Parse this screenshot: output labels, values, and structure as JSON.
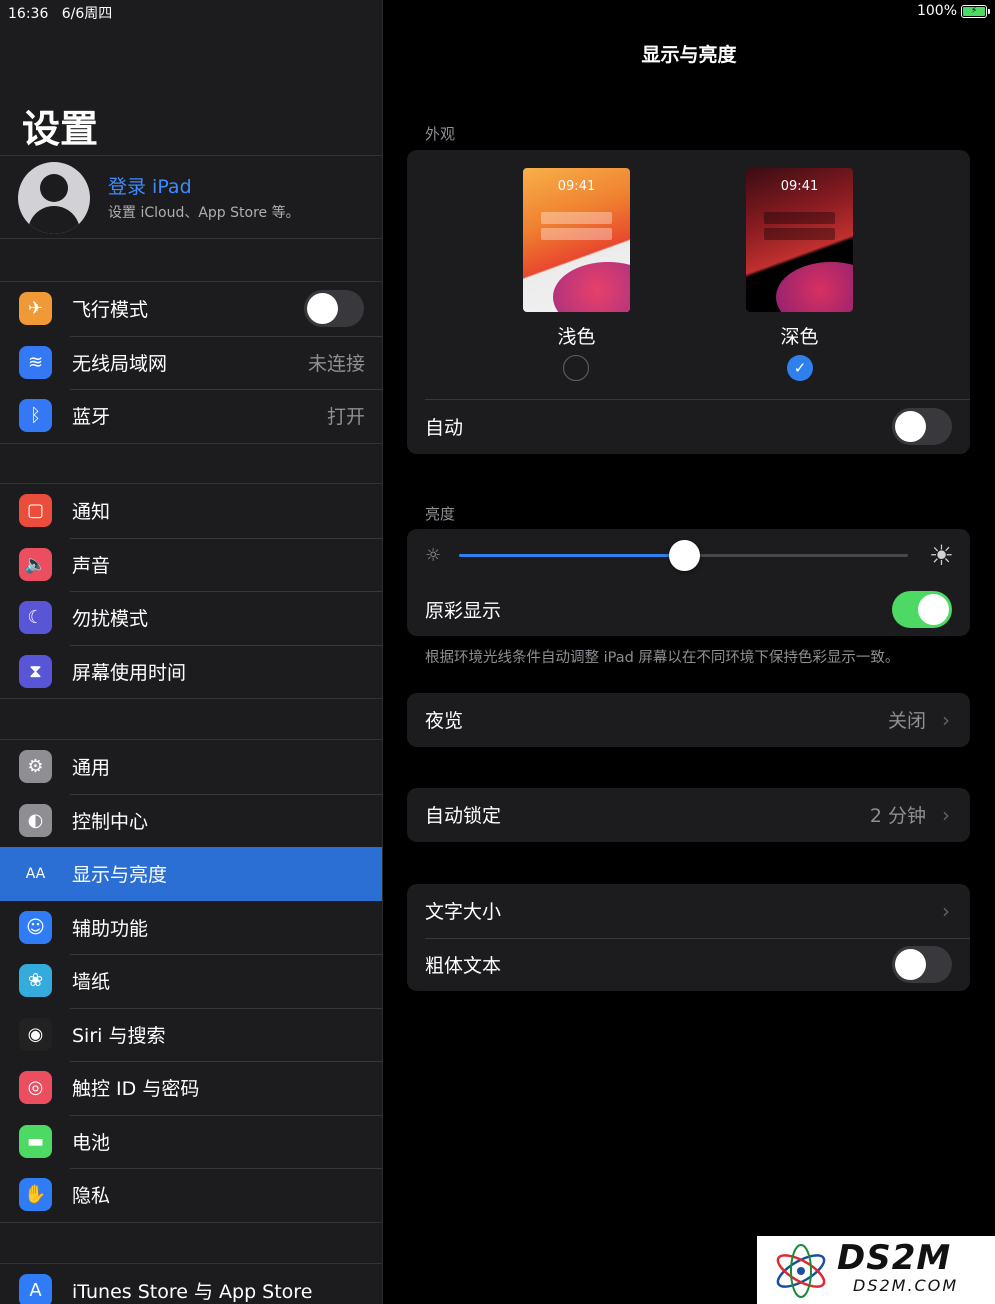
{
  "status_bar": {
    "time": "16:36",
    "date": "6/6周四",
    "battery": "100%"
  },
  "sidebar": {
    "title": "设置",
    "account": {
      "name": "登录 iPad",
      "subtitle": "设置 iCloud、App Store 等。"
    },
    "groups": [
      [
        {
          "label": "飞行模式",
          "icon": "airplane-icon",
          "color": "#f09a37",
          "toggle": false
        },
        {
          "label": "无线局域网",
          "icon": "wifi-icon",
          "color": "#3478f6",
          "value": "未连接"
        },
        {
          "label": "蓝牙",
          "icon": "bluetooth-icon",
          "color": "#3478f6",
          "value": "打开"
        }
      ],
      [
        {
          "label": "通知",
          "icon": "notification-icon",
          "color": "#eb4d3d"
        },
        {
          "label": "声音",
          "icon": "sound-icon",
          "color": "#eb4e5e"
        },
        {
          "label": "勿扰模式",
          "icon": "moon-icon",
          "color": "#5856d6"
        },
        {
          "label": "屏幕使用时间",
          "icon": "hourglass-icon",
          "color": "#5856d6"
        }
      ],
      [
        {
          "label": "通用",
          "icon": "gear-icon",
          "color": "#8e8e93"
        },
        {
          "label": "控制中心",
          "icon": "switches-icon",
          "color": "#8e8e93"
        },
        {
          "label": "显示与亮度",
          "icon": "display-icon",
          "color": "#2f6fdb",
          "icon_text": "AA",
          "selected": true
        },
        {
          "label": "辅助功能",
          "icon": "accessibility-icon",
          "color": "#2f7cf6"
        },
        {
          "label": "墙纸",
          "icon": "flower-icon",
          "color": "#35aadc"
        },
        {
          "label": "Siri 与搜索",
          "icon": "siri-icon",
          "color": "#222222"
        },
        {
          "label": "触控 ID 与密码",
          "icon": "fingerprint-icon",
          "color": "#eb4e5e"
        },
        {
          "label": "电池",
          "icon": "battery-icon",
          "color": "#4cd964"
        },
        {
          "label": "隐私",
          "icon": "hand-icon",
          "color": "#2f7cf6"
        }
      ],
      [
        {
          "label": "iTunes Store 与 App Store",
          "icon": "app-store-icon",
          "color": "#2f7cf6"
        }
      ]
    ]
  },
  "detail": {
    "title": "显示与亮度",
    "appearance": {
      "header": "外观",
      "light": {
        "label": "浅色",
        "time": "09:41",
        "checked": false
      },
      "dark": {
        "label": "深色",
        "time": "09:41",
        "checked": true
      },
      "auto_label": "自动",
      "auto_on": false
    },
    "brightness": {
      "header": "亮度",
      "level": 0.5,
      "true_tone_label": "原彩显示",
      "true_tone_on": true,
      "footnote": "根据环境光线条件自动调整 iPad 屏幕以在不同环境下保持色彩显示一致。"
    },
    "night_shift": {
      "label": "夜览",
      "value": "关闭"
    },
    "auto_lock": {
      "label": "自动锁定",
      "value": "2 分钟"
    },
    "text_size": {
      "label": "文字大小"
    },
    "bold_text": {
      "label": "粗体文本",
      "on": false
    }
  },
  "watermark": {
    "main": "DS2M",
    "sub": "DS2M.COM"
  }
}
